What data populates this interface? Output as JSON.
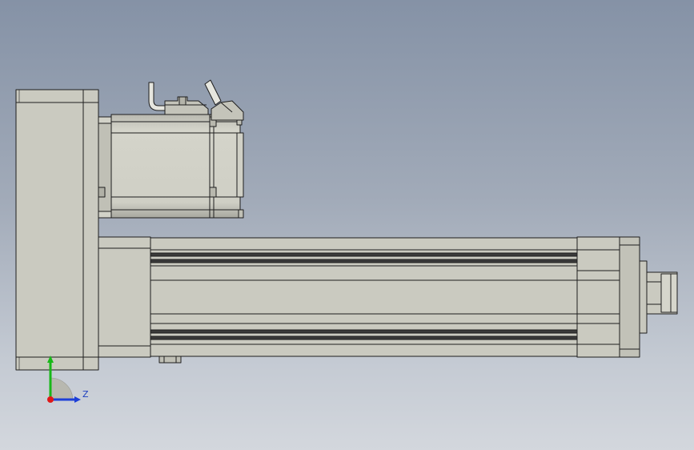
{
  "triad": {
    "z_label": "Z",
    "colors": {
      "x": "#e01818",
      "y": "#18b818",
      "z": "#1d3fd8"
    }
  },
  "model": {
    "body_color": "#cacac0",
    "edge_color": "#1e1e1e",
    "shade_color": "#a9a9a0",
    "dark_slot_color": "#3a3a3a"
  }
}
